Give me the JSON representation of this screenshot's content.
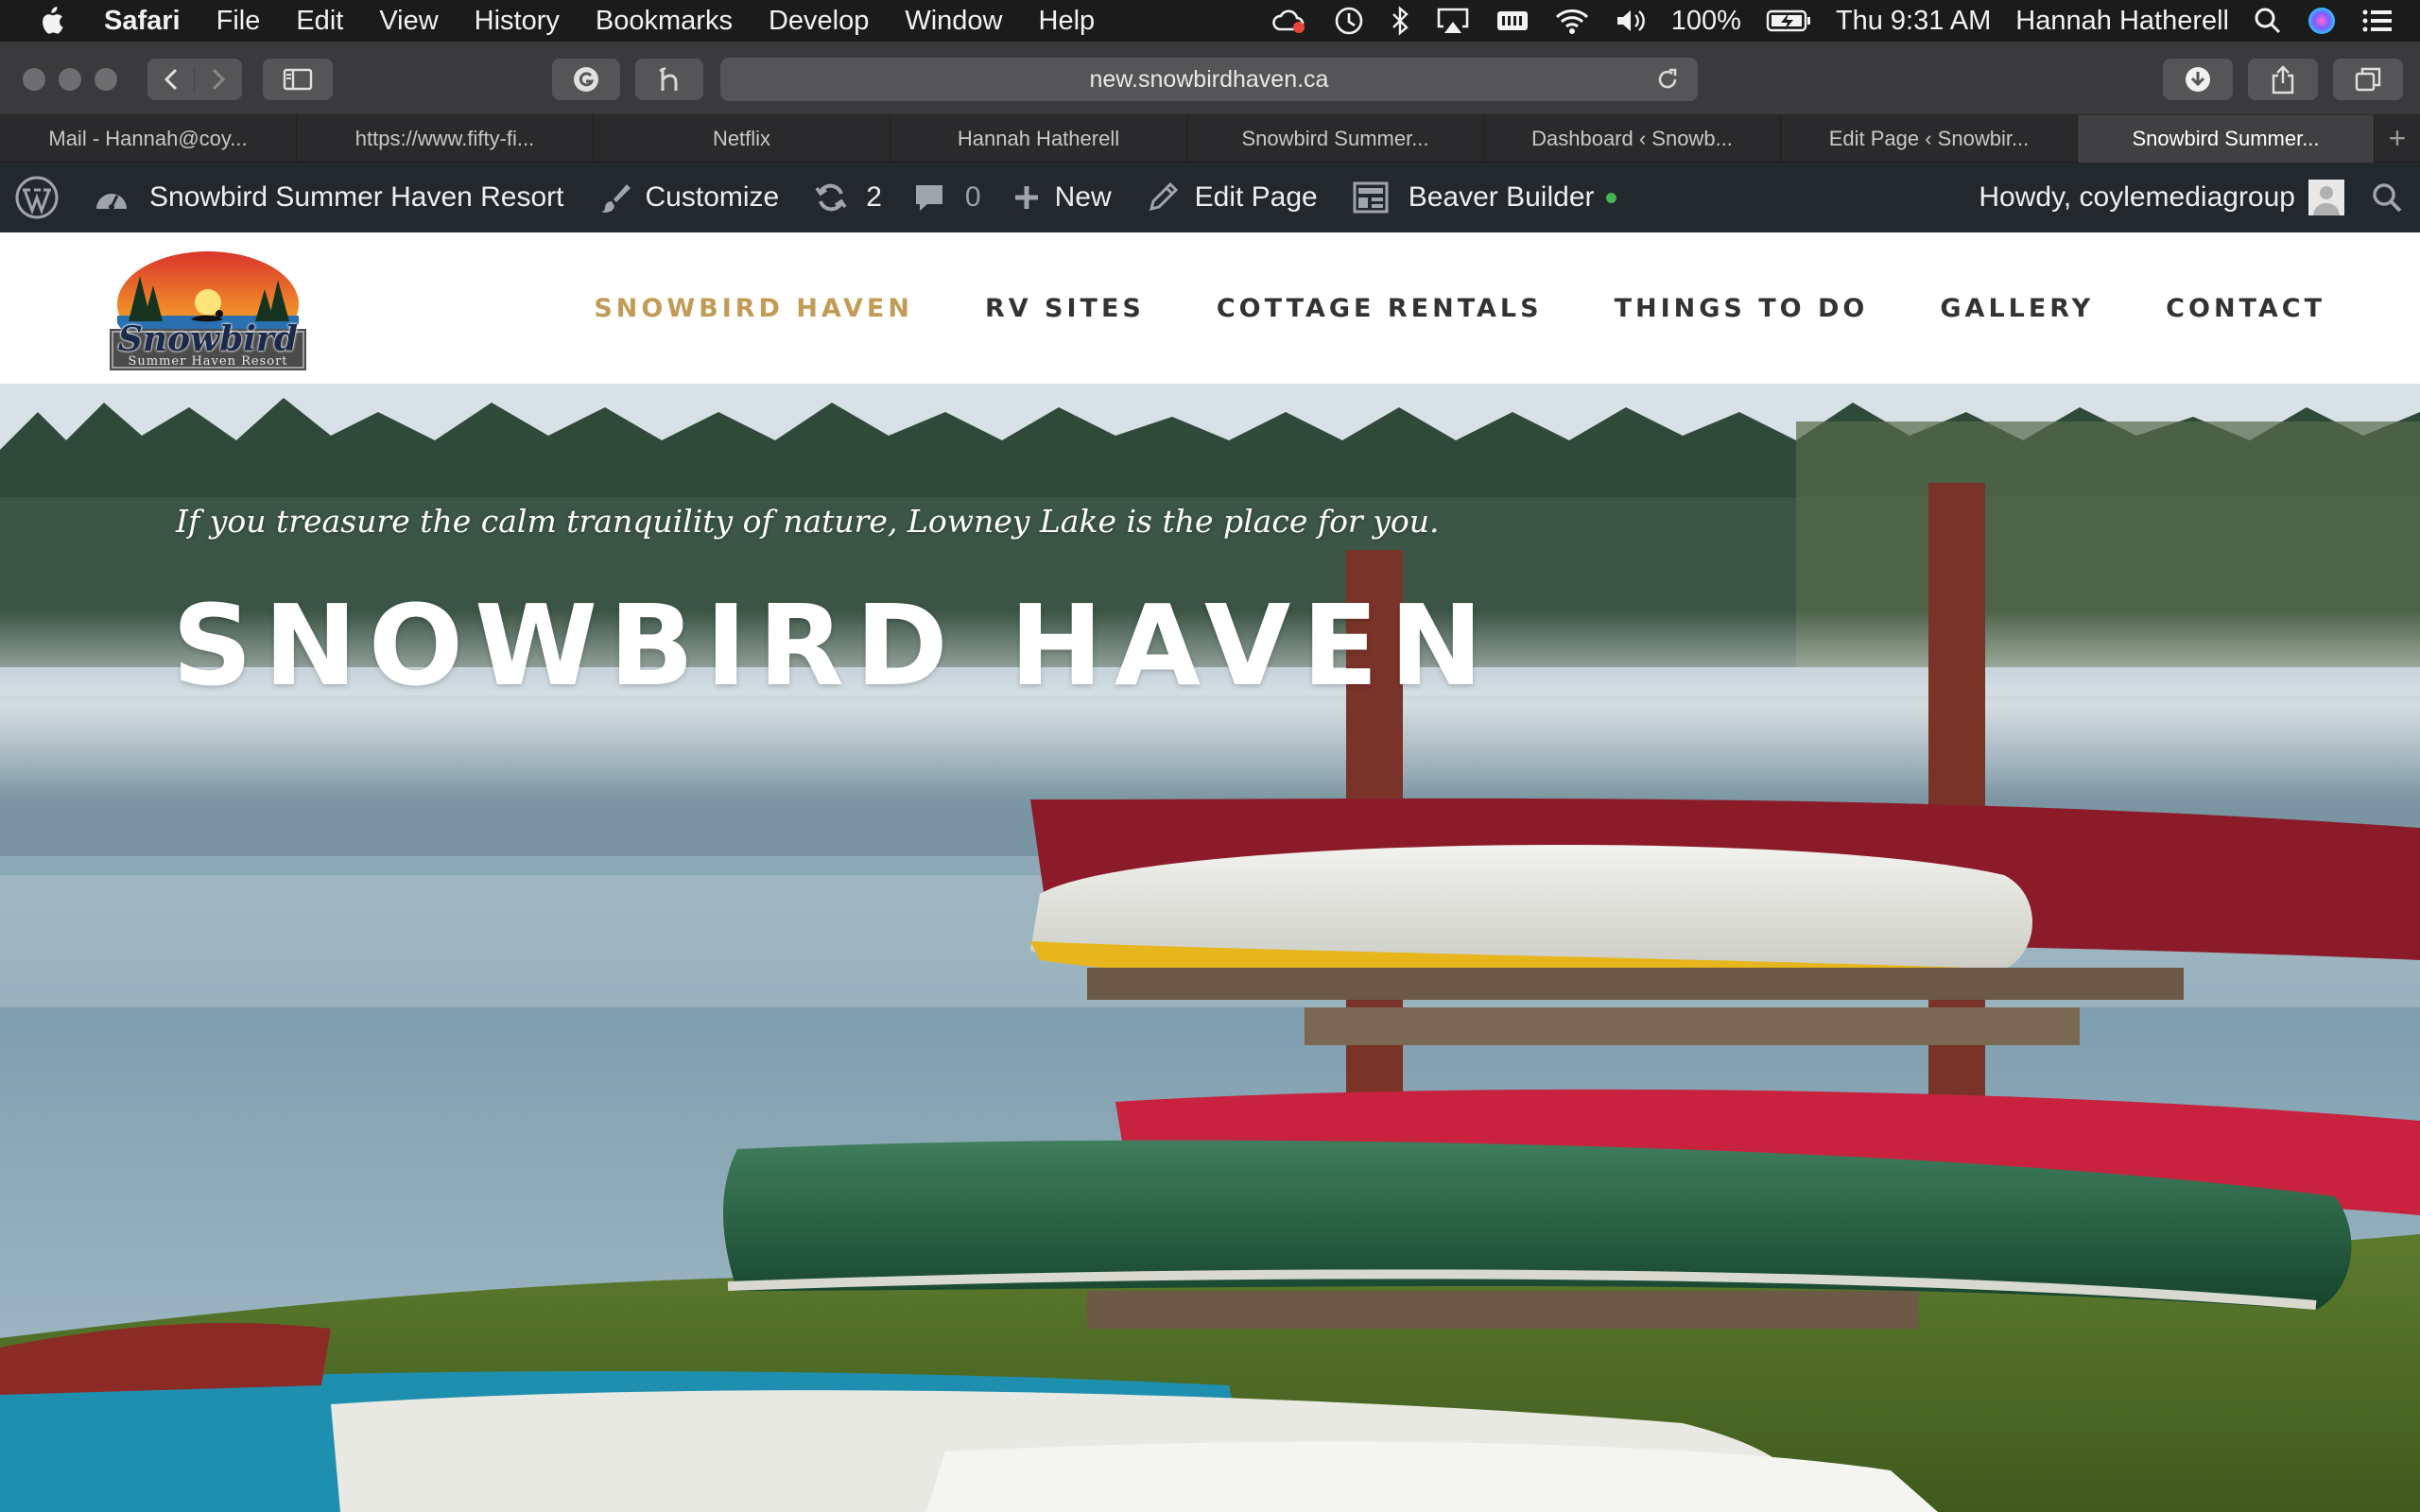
{
  "menubar": {
    "app": "Safari",
    "menus": [
      "File",
      "Edit",
      "View",
      "History",
      "Bookmarks",
      "Develop",
      "Window",
      "Help"
    ],
    "battery": "100%",
    "clock": "Thu 9:31 AM",
    "user": "Hannah Hatherell"
  },
  "toolbar": {
    "url": "new.snowbirdhaven.ca"
  },
  "tabs": [
    {
      "label": "Mail - Hannah@coy..."
    },
    {
      "label": "https://www.fifty-fi..."
    },
    {
      "label": "Netflix"
    },
    {
      "label": "Hannah Hatherell"
    },
    {
      "label": "Snowbird Summer..."
    },
    {
      "label": "Dashboard ‹ Snowb..."
    },
    {
      "label": "Edit Page ‹ Snowbir..."
    },
    {
      "label": "Snowbird Summer..."
    }
  ],
  "wpbar": {
    "site_name": "Snowbird Summer Haven Resort",
    "customize": "Customize",
    "updates": "2",
    "comments": "0",
    "new": "New",
    "edit_page": "Edit Page",
    "beaver_builder": "Beaver Builder",
    "howdy": "Howdy, coylemediagroup"
  },
  "site": {
    "logo_text": "Snowbird",
    "logo_subtext": "Summer Haven Resort",
    "nav": [
      "SNOWBIRD HAVEN",
      "RV SITES",
      "COTTAGE RENTALS",
      "THINGS TO DO",
      "GALLERY",
      "CONTACT"
    ],
    "tagline": "If you treasure the calm tranquility of nature, Lowney Lake is the place for you.",
    "hero_title": "SNOWBIRD HAVEN"
  },
  "colors": {
    "nav_active": "#c29b57",
    "wp_bar_bg": "#23282d",
    "status_dot": "#46b450"
  }
}
